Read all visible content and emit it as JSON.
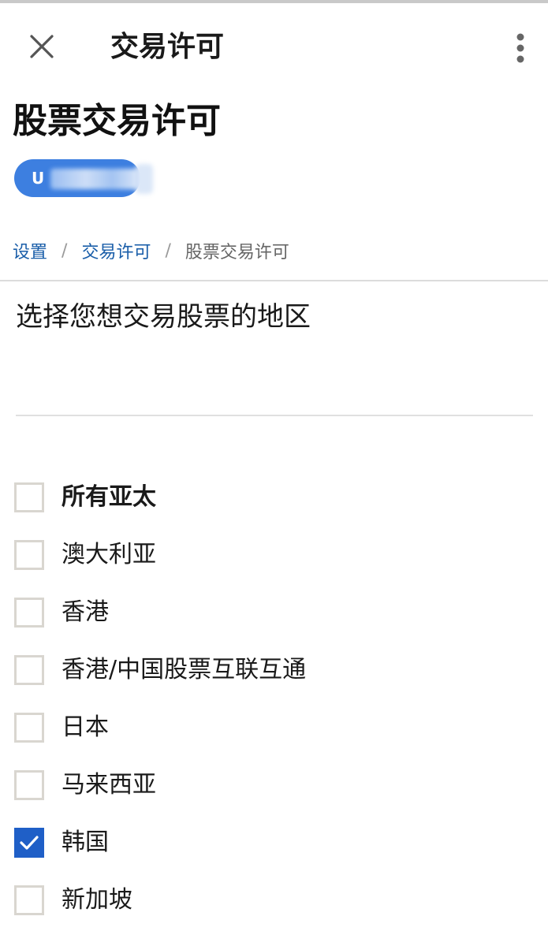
{
  "topbar": {
    "title": "交易许可",
    "close_icon": "close-icon",
    "more_icon": "more-vertical-icon"
  },
  "page": {
    "title": "股票交易许可"
  },
  "account": {
    "id_visible_prefix": "U",
    "badge_color": "#3d7fe0"
  },
  "breadcrumb": {
    "items": [
      "设置",
      "交易许可"
    ],
    "current": "股票交易许可",
    "separator": "/",
    "link_color": "#1a5ea9"
  },
  "section": {
    "title": "选择您想交易股票的地区"
  },
  "regions": [
    {
      "label": "所有亚太",
      "checked": false,
      "bold": true
    },
    {
      "label": "澳大利亚",
      "checked": false,
      "bold": false
    },
    {
      "label": "香港",
      "checked": false,
      "bold": false
    },
    {
      "label": "香港/中国股票互联互通",
      "checked": false,
      "bold": false
    },
    {
      "label": "日本",
      "checked": false,
      "bold": false
    },
    {
      "label": "马来西亚",
      "checked": false,
      "bold": false
    },
    {
      "label": "韩国",
      "checked": true,
      "bold": false
    },
    {
      "label": "新加坡",
      "checked": false,
      "bold": false
    }
  ],
  "colors": {
    "checkbox_checked": "#1f5fc7",
    "checkbox_border": "#d9d6d0"
  }
}
